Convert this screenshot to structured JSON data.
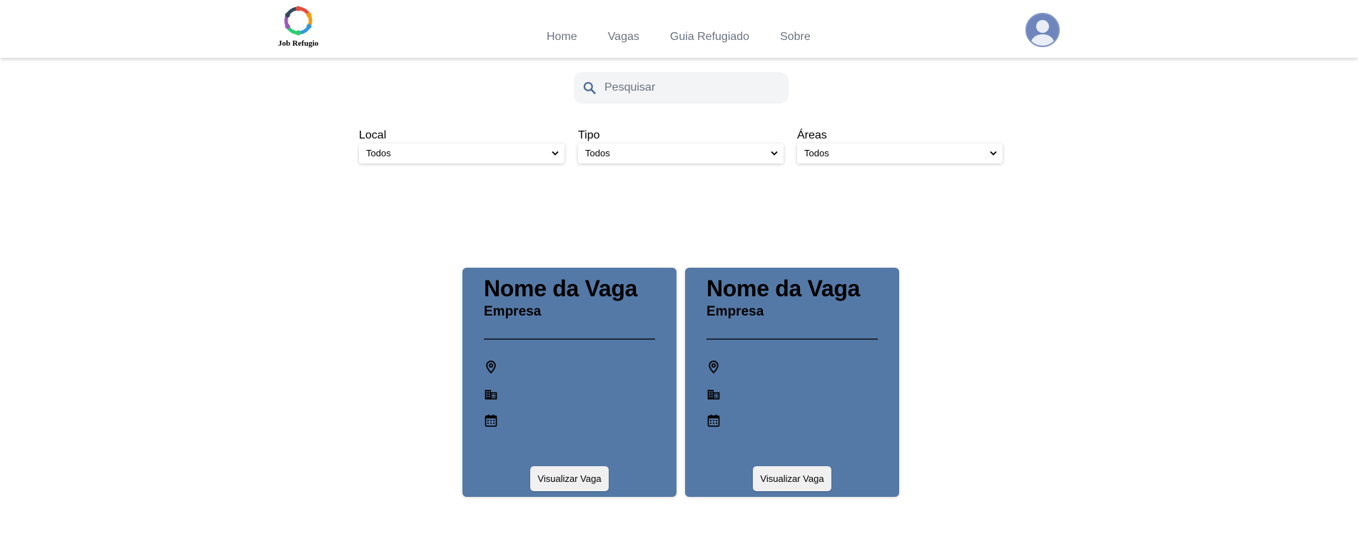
{
  "header": {
    "logo_text": "Job Refugio",
    "nav": [
      {
        "label": "Home"
      },
      {
        "label": "Vagas"
      },
      {
        "label": "Guia Refugiado"
      },
      {
        "label": "Sobre"
      }
    ],
    "avatar_icon": "user-avatar-icon"
  },
  "search": {
    "placeholder": "Pesquisar",
    "icon": "search-icon"
  },
  "filters": [
    {
      "label": "Local",
      "value": "Todos"
    },
    {
      "label": "Tipo",
      "value": "Todos"
    },
    {
      "label": "Áreas",
      "value": "Todos"
    }
  ],
  "cards": [
    {
      "title": "Nome da Vaga",
      "company": "Empresa",
      "icons": [
        "location-pin-icon",
        "building-icon",
        "calendar-icon"
      ],
      "button_label": "Visualizar Vaga"
    },
    {
      "title": "Nome da Vaga",
      "company": "Empresa",
      "icons": [
        "location-pin-icon",
        "building-icon",
        "calendar-icon"
      ],
      "button_label": "Visualizar Vaga"
    }
  ],
  "colors": {
    "card_bg": "#5579a6",
    "nav_text": "#6b7280",
    "search_bg": "#f3f4f6",
    "avatar_bg": "#6f86bd"
  }
}
